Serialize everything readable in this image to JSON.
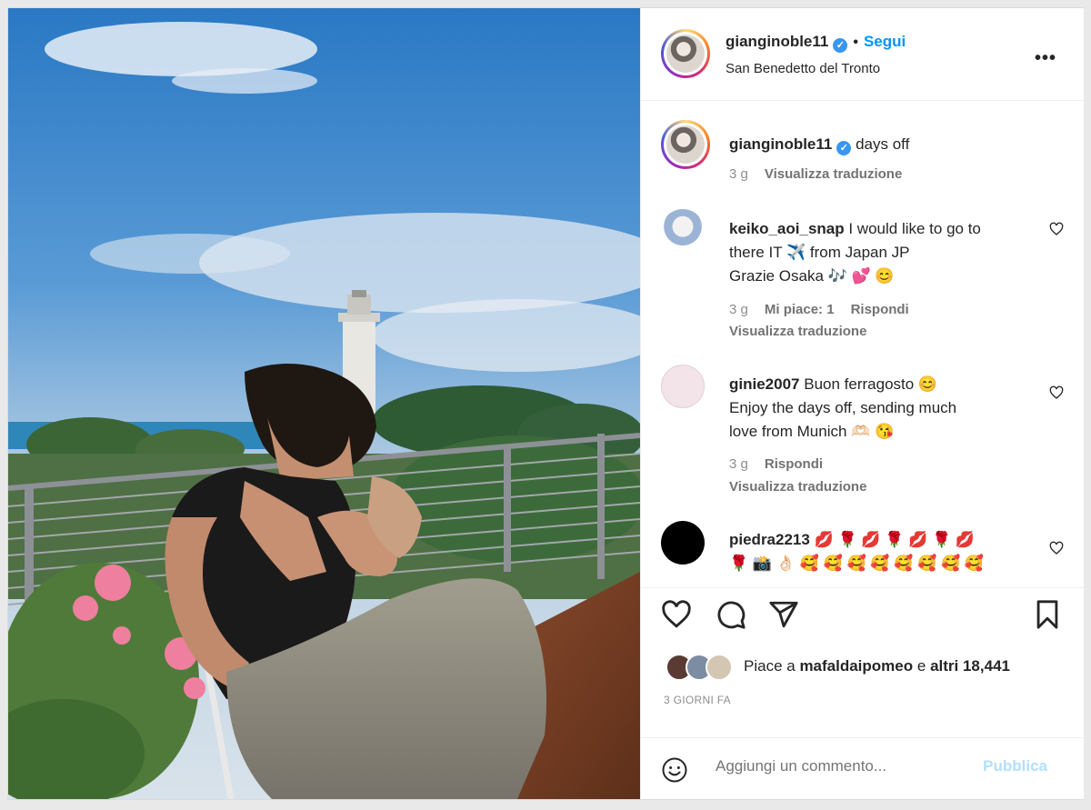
{
  "post": {
    "username": "gianginoble11",
    "follow_label": "Segui",
    "location": "San Benedetto del Tronto",
    "more_label": "•••",
    "caption": "days off",
    "caption_time": "3 g",
    "translate_label": "Visualizza traduzione"
  },
  "comments": [
    {
      "username": "keiko_aoi_snap",
      "line1": "I would like to go to",
      "line2": "there IT ✈️  from Japan JP",
      "line3": "Grazie Osaka 🎶 💕 😊",
      "time": "3 g",
      "likes": "Mi piace: 1",
      "reply": "Rispondi",
      "translate": "Visualizza traduzione"
    },
    {
      "username": "ginie2007",
      "line1": "Buon ferragosto 😊",
      "line2": "Enjoy the days off, sending much",
      "line3": "love from Munich 🫶🏻 😘",
      "time": "3 g",
      "reply": "Rispondi",
      "translate": "Visualizza traduzione"
    },
    {
      "username": "piedra2213",
      "line1": "💋 🌹 💋 🌹 💋 🌹 💋",
      "line2": "🌹 📸 👌🏻 🥰 🥰 🥰 🥰 🥰 🥰 🥰 🥰"
    }
  ],
  "likes": {
    "prefix": "Piace a",
    "user": "mafaldaipomeo",
    "middle": "e",
    "others": "altri 18,441"
  },
  "timestamp": "3 GIORNI FA",
  "composer": {
    "placeholder": "Aggiungi un commento...",
    "publish_label": "Pubblica"
  },
  "colors": {
    "accent": "#0095f6",
    "verified": "#3897f0",
    "publish_disabled": "#b2dffc"
  },
  "icons": [
    "heart-icon",
    "comment-icon",
    "share-icon",
    "bookmark-icon",
    "emoji-icon",
    "verified-badge-icon",
    "more-options-icon"
  ]
}
